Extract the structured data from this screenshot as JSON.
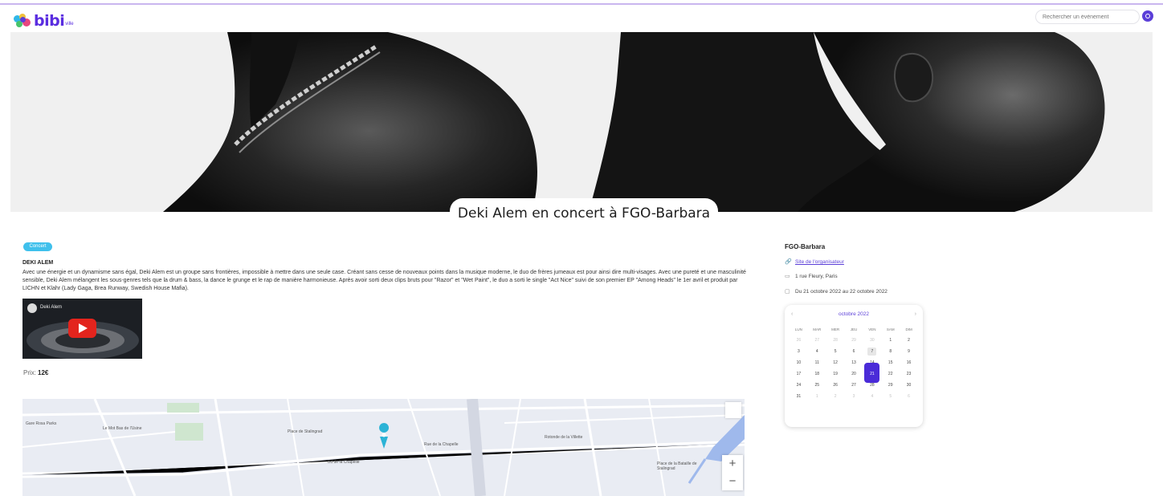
{
  "header": {
    "logo_text": "bibi",
    "logo_sub": "ville",
    "search_placeholder": "Rechercher un évènement"
  },
  "hero": {
    "title": "Deki Alem en concert à FGO-Barbara"
  },
  "event": {
    "tag": "Concert",
    "artist": "DEKI ALEM",
    "description": "Avec une énergie et un dynamisme sans égal, Deki Alem est un groupe sans frontières, impossible à mettre dans une seule case. Créant sans cesse de nouveaux points dans la musique moderne, le duo de frères jumeaux est pour ainsi dire multi-visages. Avec une pureté et une masculinité sensible, Deki Alem mélangent les sous-genres tels que la drum & bass, la dance le grunge et le rap de manière harmonieuse. Après avoir sorti deux clips bruts pour \"Razor\" et \"Wet Paint\", le duo a sorti le single \"Act Nice\" suivi de son premier EP \"Among Heads\" le 1er avril et produit par LICHN et Klahr (Lady Gaga, Brea Runway, Swedish House Mafia).",
    "video_label": "Deki Alem",
    "price_label": "Prix:",
    "price_value": "12€"
  },
  "sidebar": {
    "venue": "FGO-Barbara",
    "website_link": "Site de l'organisateur",
    "address": "1 rue Fleury, Paris",
    "dates": "Du 21 octobre 2022 au 22 octobre 2022"
  },
  "calendar": {
    "month_label": "octobre 2022",
    "day_names": [
      "LUN",
      "MAR",
      "MER",
      "JEU",
      "VEN",
      "SAM",
      "DIM"
    ],
    "weeks": [
      [
        "26",
        "27",
        "28",
        "29",
        "30",
        "1",
        "2"
      ],
      [
        "3",
        "4",
        "5",
        "6",
        "7",
        "8",
        "9"
      ],
      [
        "10",
        "11",
        "12",
        "13",
        "14",
        "15",
        "16"
      ],
      [
        "17",
        "18",
        "19",
        "20",
        "21",
        "22",
        "23"
      ],
      [
        "24",
        "25",
        "26",
        "27",
        "28",
        "29",
        "30"
      ],
      [
        "31",
        "1",
        "2",
        "3",
        "4",
        "5",
        "6"
      ]
    ],
    "today": "7",
    "selected": "21"
  },
  "map": {
    "labels": [
      "Gare Rosa Parks",
      "Le Mot Bas de l'Usine",
      "Place de Stalingrad",
      "Rotonde de la Villette",
      "Rue de la Chapelle",
      "Bd de la Chapelle",
      "Place de la Bataille de Stalingrad"
    ],
    "zoom_in": "+",
    "zoom_out": "−"
  },
  "colors": {
    "accent": "#5b3fd8",
    "tag": "#3fc0ec",
    "selected_day": "#4a2bd8"
  }
}
